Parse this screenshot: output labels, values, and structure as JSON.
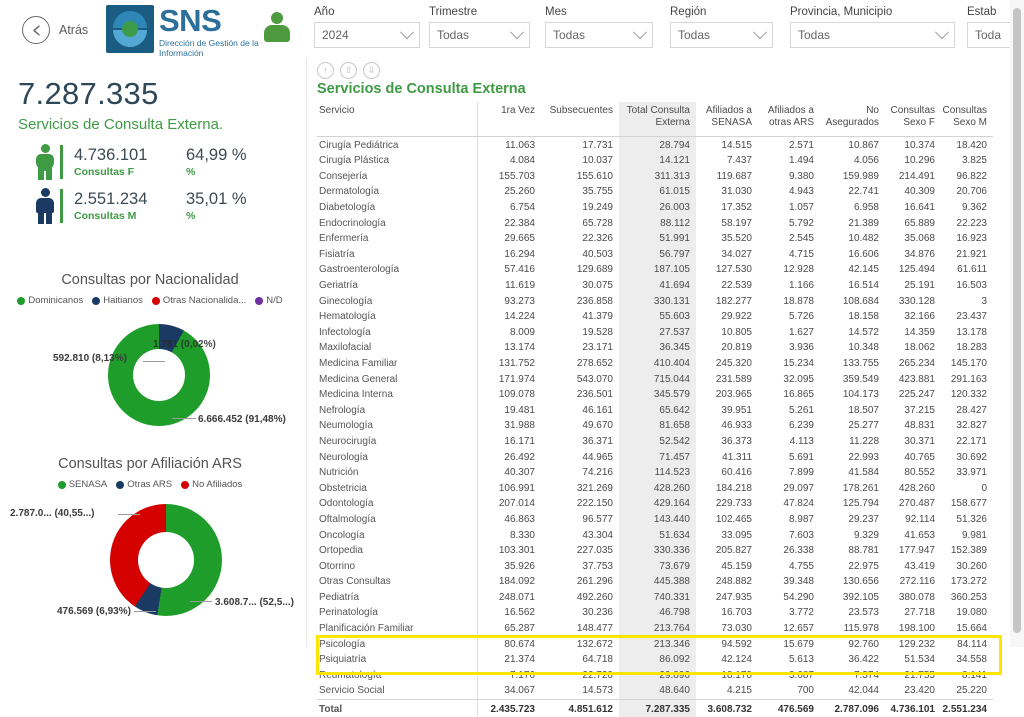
{
  "header": {
    "back_label": "Atrás",
    "back_icon": "arrow-left-circle-icon",
    "logo_title": "SNS",
    "logo_subtitle": "Dirección de Gestión de la Información",
    "user_icon": "user-avatar-icon"
  },
  "filters": [
    {
      "label": "Año",
      "value": "2024",
      "icon": "chevron-down-icon"
    },
    {
      "label": "Trimestre",
      "value": "Todas",
      "icon": "chevron-down-icon"
    },
    {
      "label": "Mes",
      "value": "Todas",
      "icon": "chevron-down-icon"
    },
    {
      "label": "Región",
      "value": "Todas",
      "icon": "chevron-down-icon"
    },
    {
      "label": "Provincia, Municipio",
      "value": "Todas",
      "icon": "chevron-down-icon"
    },
    {
      "label": "Estab",
      "value": "Toda",
      "icon": "chevron-down-icon"
    }
  ],
  "kpi": {
    "total": "7.287.335",
    "total_label": "Servicios de Consulta Externa.",
    "female": {
      "value": "4.736.101",
      "label": "Consultas F",
      "percent": "64,99 %",
      "percent_label": "%",
      "color": "#3f9a44"
    },
    "male": {
      "value": "2.551.234",
      "label": "Consultas M",
      "percent": "35,01 %",
      "percent_label": "%",
      "color": "#1b3a63"
    }
  },
  "chart_data": [
    {
      "type": "pie",
      "title": "Consultas por Nacionalidad",
      "legend_position": "top",
      "categories": [
        "Dominicanos",
        "Haitianos",
        "Otras Nacionalida...",
        "N/D"
      ],
      "values": [
        6666452,
        592810,
        1781,
        1781
      ],
      "percents": [
        91.48,
        8.13,
        0.02,
        0.02
      ],
      "colors": [
        "#1f9d2b",
        "#1b3a63",
        "#d40000",
        "#7030a0"
      ],
      "labels": [
        "6.666.452 (91,48%)",
        "592.810 (8,13%)",
        "1.781 (0,02%)",
        ""
      ]
    },
    {
      "type": "pie",
      "title": "Consultas por Afiliación ARS",
      "legend_position": "top",
      "categories": [
        "SENASA",
        "Otras ARS",
        "No Afiliados"
      ],
      "values": [
        3608732,
        476569,
        2787096
      ],
      "percents": [
        52.5,
        6.93,
        40.55
      ],
      "colors": [
        "#1f9d2b",
        "#1b3a63",
        "#d40000"
      ],
      "labels": [
        "3.608.7... (52,5...)",
        "476.569 (6,93%)",
        "2.787.0... (40,55...)"
      ]
    }
  ],
  "panel": {
    "title": "Servicios de Consulta Externa",
    "icons": [
      "drill-up-icon",
      "expand-all-icon",
      "drill-down-icon"
    ]
  },
  "table": {
    "columns": [
      "Servicio",
      "1ra Vez",
      "Subsecuentes",
      "Total Consulta Externa",
      "Afiliados a SENASA",
      "Afiliados a otras ARS",
      "No Asegurados",
      "Consultas Sexo F",
      "Consultas Sexo M"
    ],
    "rows": [
      [
        "Cirugía Pediátrica",
        "11.063",
        "17.731",
        "28.794",
        "14.515",
        "2.571",
        "10.867",
        "10.374",
        "18.420"
      ],
      [
        "Cirugía Plástica",
        "4.084",
        "10.037",
        "14.121",
        "7.437",
        "1.494",
        "4.056",
        "10.296",
        "3.825"
      ],
      [
        "Consejería",
        "155.703",
        "155.610",
        "311.313",
        "119.687",
        "9.380",
        "159.989",
        "214.491",
        "96.822"
      ],
      [
        "Dermatología",
        "25.260",
        "35.755",
        "61.015",
        "31.030",
        "4.943",
        "22.741",
        "40.309",
        "20.706"
      ],
      [
        "Diabetología",
        "6.754",
        "19.249",
        "26.003",
        "17.352",
        "1.057",
        "6.958",
        "16.641",
        "9.362"
      ],
      [
        "Endocrinología",
        "22.384",
        "65.728",
        "88.112",
        "58.197",
        "5.792",
        "21.389",
        "65.889",
        "22.223"
      ],
      [
        "Enfermería",
        "29.665",
        "22.326",
        "51.991",
        "35.520",
        "2.545",
        "10.482",
        "35.068",
        "16.923"
      ],
      [
        "Fisiatría",
        "16.294",
        "40.503",
        "56.797",
        "34.027",
        "4.715",
        "16.606",
        "34.876",
        "21.921"
      ],
      [
        "Gastroenterología",
        "57.416",
        "129.689",
        "187.105",
        "127.530",
        "12.928",
        "42.145",
        "125.494",
        "61.611"
      ],
      [
        "Geriatría",
        "11.619",
        "30.075",
        "41.694",
        "22.539",
        "1.166",
        "16.514",
        "25.191",
        "16.503"
      ],
      [
        "Ginecología",
        "93.273",
        "236.858",
        "330.131",
        "182.277",
        "18.878",
        "108.684",
        "330.128",
        "3"
      ],
      [
        "Hematología",
        "14.224",
        "41.379",
        "55.603",
        "29.922",
        "5.726",
        "18.158",
        "32.166",
        "23.437"
      ],
      [
        "Infectología",
        "8.009",
        "19.528",
        "27.537",
        "10.805",
        "1.627",
        "14.572",
        "14.359",
        "13.178"
      ],
      [
        "Maxilofacial",
        "13.174",
        "23.171",
        "36.345",
        "20.819",
        "3.936",
        "10.348",
        "18.062",
        "18.283"
      ],
      [
        "Medicina Familiar",
        "131.752",
        "278.652",
        "410.404",
        "245.320",
        "15.234",
        "133.755",
        "265.234",
        "145.170"
      ],
      [
        "Medicina General",
        "171.974",
        "543.070",
        "715.044",
        "231.589",
        "32.095",
        "359.549",
        "423.881",
        "291.163"
      ],
      [
        "Medicina Interna",
        "109.078",
        "236.501",
        "345.579",
        "203.965",
        "16.865",
        "104.173",
        "225.247",
        "120.332"
      ],
      [
        "Nefrología",
        "19.481",
        "46.161",
        "65.642",
        "39.951",
        "5.261",
        "18.507",
        "37.215",
        "28.427"
      ],
      [
        "Neumología",
        "31.988",
        "49.670",
        "81.658",
        "46.933",
        "6.239",
        "25.277",
        "48.831",
        "32.827"
      ],
      [
        "Neurocirugía",
        "16.171",
        "36.371",
        "52.542",
        "36.373",
        "4.113",
        "11.228",
        "30.371",
        "22.171"
      ],
      [
        "Neurología",
        "26.492",
        "44.965",
        "71.457",
        "41.311",
        "5.691",
        "22.993",
        "40.765",
        "30.692"
      ],
      [
        "Nutrición",
        "40.307",
        "74.216",
        "114.523",
        "60.416",
        "7.899",
        "41.584",
        "80.552",
        "33.971"
      ],
      [
        "Obstetricia",
        "106.991",
        "321.269",
        "428.260",
        "184.218",
        "29.097",
        "178.261",
        "428.260",
        "0"
      ],
      [
        "Odontología",
        "207.014",
        "222.150",
        "429.164",
        "229.733",
        "47.824",
        "125.794",
        "270.487",
        "158.677"
      ],
      [
        "Oftalmología",
        "46.863",
        "96.577",
        "143.440",
        "102.465",
        "8.987",
        "29.237",
        "92.114",
        "51.326"
      ],
      [
        "Oncología",
        "8.330",
        "43.304",
        "51.634",
        "33.095",
        "7.603",
        "9.329",
        "41.653",
        "9.981"
      ],
      [
        "Ortopedia",
        "103.301",
        "227.035",
        "330.336",
        "205.827",
        "26.338",
        "88.781",
        "177.947",
        "152.389"
      ],
      [
        "Otorrino",
        "35.926",
        "37.753",
        "73.679",
        "45.159",
        "4.755",
        "22.975",
        "43.419",
        "30.260"
      ],
      [
        "Otras Consultas",
        "184.092",
        "261.296",
        "445.388",
        "248.882",
        "39.348",
        "130.656",
        "272.116",
        "173.272"
      ],
      [
        "Pediatría",
        "248.071",
        "492.260",
        "740.331",
        "247.935",
        "54.290",
        "392.105",
        "380.078",
        "360.253"
      ],
      [
        "Perinatología",
        "16.562",
        "30.236",
        "46.798",
        "16.703",
        "3.772",
        "23.573",
        "27.718",
        "19.080"
      ],
      [
        "Planificación Familiar",
        "65.287",
        "148.477",
        "213.764",
        "73.030",
        "12.657",
        "115.978",
        "198.100",
        "15.664"
      ],
      [
        "Psicología",
        "80.674",
        "132.672",
        "213.346",
        "94.592",
        "15.679",
        "92.760",
        "129.232",
        "84.114"
      ],
      [
        "Psiquiatría",
        "21.374",
        "64.718",
        "86.092",
        "42.124",
        "5.613",
        "36.422",
        "51.534",
        "34.558"
      ],
      [
        "Reumatología",
        "7.176",
        "22.720",
        "29.896",
        "18.170",
        "3.687",
        "7.374",
        "21.755",
        "8.141"
      ],
      [
        "Servicio Social",
        "34.067",
        "14.573",
        "48.640",
        "4.215",
        "700",
        "42.044",
        "23.420",
        "25.220"
      ]
    ],
    "total_row": [
      "Total",
      "2.435.723",
      "4.851.612",
      "7.287.335",
      "3.608.732",
      "476.569",
      "2.787.096",
      "4.736.101",
      "2.551.234"
    ],
    "highlighted_rows": [
      "Psicología",
      "Psiquiatría"
    ],
    "highlight_color": "#ffe400",
    "highlighted_column": "Total Consulta Externa"
  }
}
